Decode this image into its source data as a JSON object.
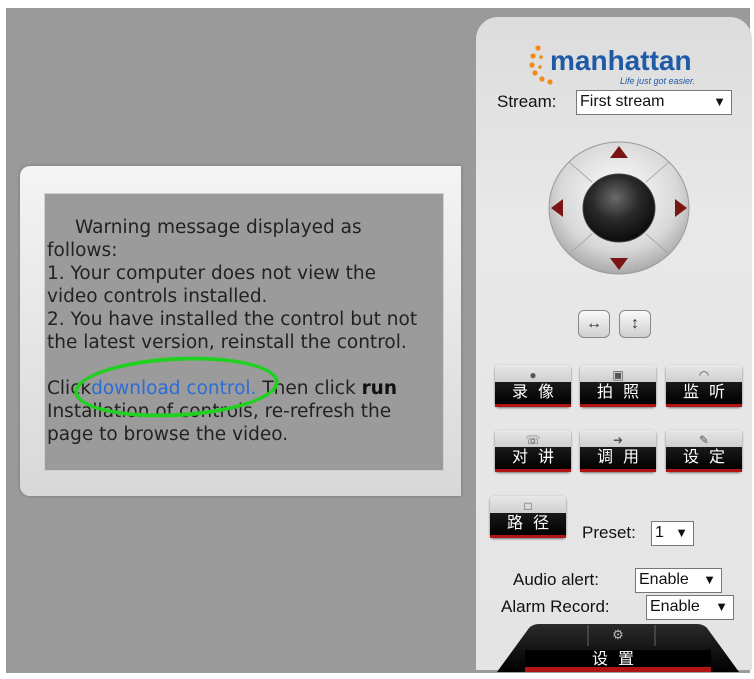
{
  "brand": {
    "logo_text": "manhattan",
    "tagline": "Life just got easier."
  },
  "stream": {
    "label": "Stream:",
    "selected": "First stream"
  },
  "warning": {
    "line1": "Warning message displayed as",
    "line2": "follows:",
    "line3": "1. Your computer does not view the",
    "line4": "video controls installed.",
    "line5": "2. You have installed the control but not",
    "line6": "the latest version, reinstall the control.",
    "click_prefix": "Click",
    "download_link": "download control.",
    "then_click": " Then click ",
    "run": "run",
    "line8": "Installation of controls, re-refresh the",
    "line9": "page to browse the video."
  },
  "ptz": {
    "flip_horizontal": "↔",
    "flip_vertical": "↕"
  },
  "buttons": {
    "record": "录像",
    "snapshot": "拍照",
    "monitor": "监听",
    "talk": "对讲",
    "call": "调用",
    "set": "设定",
    "path": "路径"
  },
  "preset": {
    "label": "Preset:",
    "selected": "1"
  },
  "audio_alert": {
    "label": "Audio alert:",
    "selected": "Enable"
  },
  "alarm_record": {
    "label": "Alarm Record:",
    "selected": "Enable"
  },
  "settings_tab": {
    "label": "设置"
  },
  "colors": {
    "link": "#2b6cd6",
    "highlight_ring": "#21d020",
    "button_accent": "#b01515",
    "logo_orange": "#f28a1a",
    "logo_blue": "#1f5aa6"
  }
}
